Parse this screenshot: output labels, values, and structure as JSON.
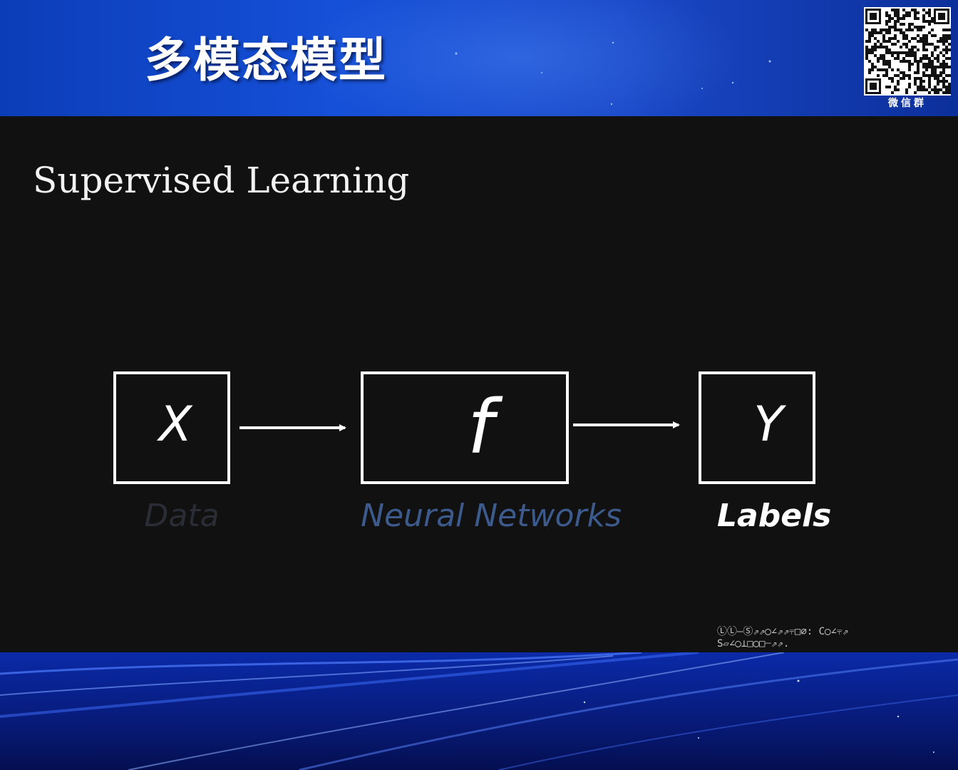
{
  "header": {
    "title": "多模态模型",
    "qr_caption": "微信群"
  },
  "slide": {
    "subtitle": "Supervised Learning",
    "diagram": {
      "input": {
        "symbol": "X",
        "label": "Data"
      },
      "model": {
        "symbol": "f",
        "label": "Neural Networks"
      },
      "output": {
        "symbol": "Y",
        "label": "Labels"
      }
    },
    "corner_text": [
      "ⓁⓁ—Ⓢ⇗⇗◯∠⇗⇗⫧□∅: C◯∠⫧⇗",
      "S▱∠◯⊥□◯□┈⇗⇗."
    ]
  },
  "colors": {
    "header_blue": "#1550d8",
    "slide_bg": "#111111",
    "data_label": "#2a2d35",
    "nn_label": "#3d5a8c",
    "labels_label": "#ffffff"
  }
}
